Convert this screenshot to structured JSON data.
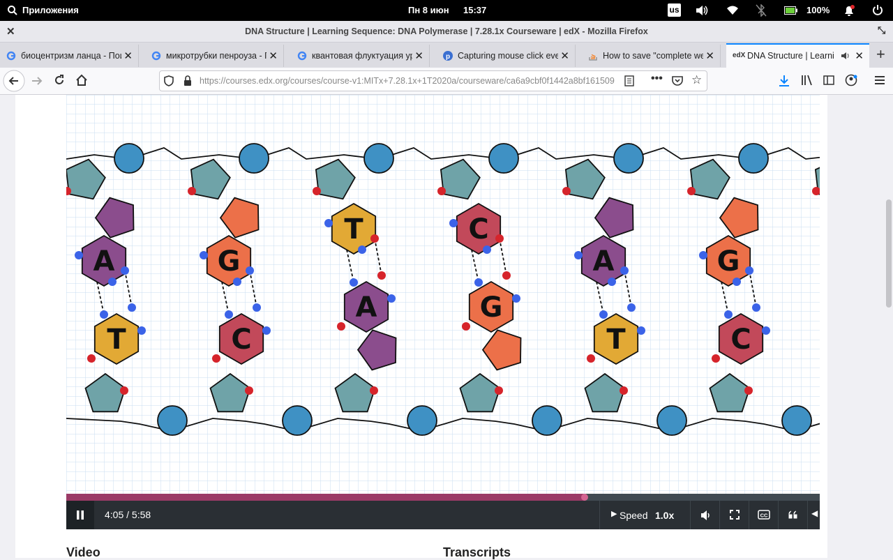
{
  "system_bar": {
    "apps_label": "Приложения",
    "date": "Пн  8 июн",
    "time": "15:37",
    "keyboard_layout": "us",
    "battery": "100%"
  },
  "window": {
    "title": "DNA Structure | Learning Sequence: DNA Polymerase | 7.28.1x Courseware | edX - Mozilla Firefox"
  },
  "tabs": [
    {
      "label": "биоцентризм ланца - Поиск",
      "icon": "google-icon"
    },
    {
      "label": "микротрубки пенроуза - Поиск",
      "icon": "google-icon"
    },
    {
      "label": "квантовая флуктуация ур",
      "icon": "google-icon"
    },
    {
      "label": "Capturing mouse click eve",
      "icon": "p-icon"
    },
    {
      "label": "How to save \"complete we",
      "icon": "stack-icon"
    },
    {
      "label": "DNA Structure | Learni",
      "icon": "edx-icon",
      "active": true
    }
  ],
  "navbar": {
    "url": "https://courses.edx.org/courses/course-v1:MITx+7.28.1x+1T2020a/courseware/ca6a9cbf0f1442a8bf161509"
  },
  "diagram": {
    "top_bases": [
      "A",
      "G",
      "T",
      "C",
      "A",
      "G"
    ],
    "bottom_bases": [
      "T",
      "C",
      "A",
      "G",
      "T",
      "C"
    ]
  },
  "player": {
    "progress_fraction": 0.688,
    "time": "4:05 / 5:58",
    "speed_label": "Speed",
    "speed_value": "1.0x"
  },
  "sections": {
    "video": "Video",
    "transcripts": "Transcripts"
  },
  "colors": {
    "purple": "#8b4d8d",
    "orange": "#ec7049",
    "gold": "#e2a935",
    "red": "#c2495a",
    "teal": "#6fa3a8",
    "phosphate": "#3f91c4",
    "blue_dot": "#3b63e8",
    "red_dot": "#d6242b"
  }
}
